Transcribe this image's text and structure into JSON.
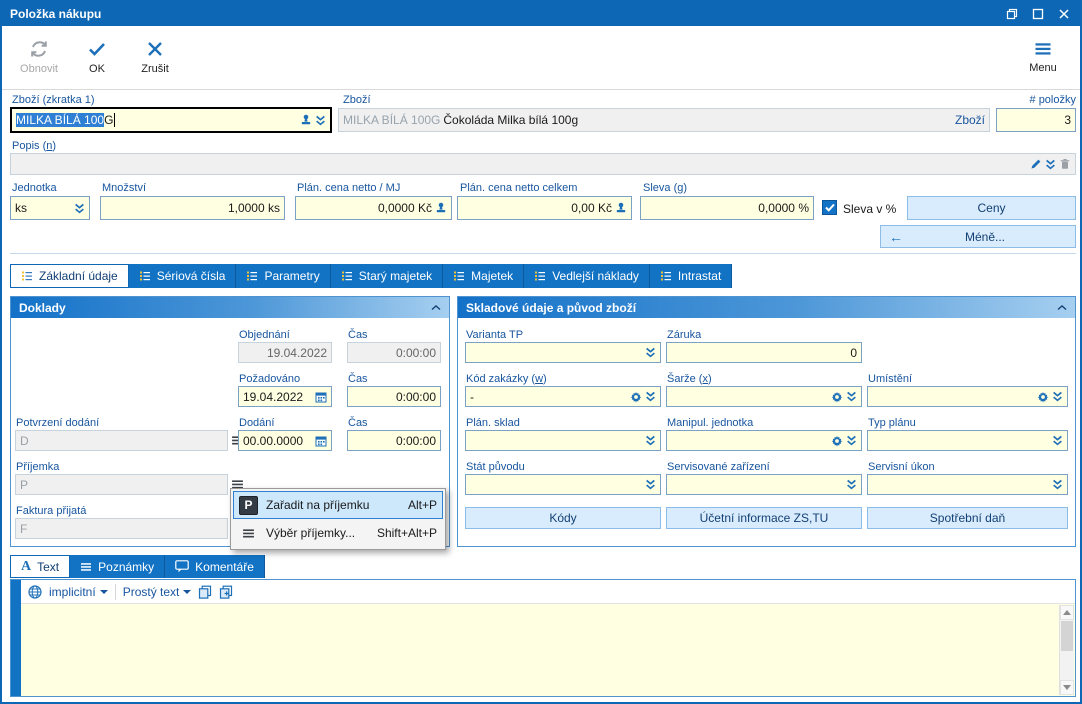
{
  "window": {
    "title": "Položka nákupu"
  },
  "toolbar": {
    "refresh_label": "Obnovit",
    "ok_label": "OK",
    "cancel_label": "Zrušit",
    "menu_label": "Menu"
  },
  "header": {
    "sku_label": "Zboží (zkratka 1)",
    "sku_selected": "MILKA BÍLÁ 100",
    "sku_rest": "G",
    "goods_label": "Zboží",
    "goods_code": "MILKA BÍLÁ 100G",
    "goods_name": "Čokoláda Milka bílá 100g",
    "goods_link": "Zboží",
    "item_count_label": "# položky",
    "item_count_value": "3",
    "desc_label": {
      "pre": "Popis (",
      "accel": "n",
      "post": ")"
    },
    "unit_label": "Jednotka",
    "unit_value": "ks",
    "qty_label": "Množství",
    "qty_value": "1,0000 ks",
    "price_unit_label": "Plán. cena netto / MJ",
    "price_unit_value": "0,0000 Kč",
    "price_total_label": "Plán. cena netto celkem",
    "price_total_value": "0,00 Kč",
    "discount_label": {
      "pre": "Sleva (",
      "accel": "g",
      "post": ")"
    },
    "discount_value": "0,0000 %",
    "discount_mode_label": "Sleva v %",
    "prices_button": "Ceny",
    "less_arrow": "←",
    "less_button": "Méně..."
  },
  "tabs": [
    {
      "label": "Základní údaje"
    },
    {
      "label": "Sériová čísla"
    },
    {
      "label": "Parametry"
    },
    {
      "label": "Starý majetek"
    },
    {
      "label": "Majetek"
    },
    {
      "label": "Vedlejší náklady"
    },
    {
      "label": "Intrastat"
    }
  ],
  "documents": {
    "title": "Doklady",
    "order_label": "Objednání",
    "time_label": "Čas",
    "order_date": "19.04.2022",
    "order_time": "0:00:00",
    "requested_label": "Požadováno",
    "requested_date": "19.04.2022",
    "requested_time": "0:00:00",
    "confirm_label": "Potvrzení dodání",
    "confirm_value": "D",
    "delivery_label": "Dodání",
    "delivery_date": "00.00.0000",
    "delivery_time": "0:00:00",
    "receipt_label": "Příjemka",
    "receipt_value": "P",
    "invoice_label": "Faktura přijatá",
    "invoice_value": "F"
  },
  "context_menu": {
    "item1_icon": "P",
    "item1_label": "Zařadit na příjemku",
    "item1_shortcut": "Alt+P",
    "item2_label": "Výběr příjemky...",
    "item2_shortcut": "Shift+Alt+P"
  },
  "stock": {
    "title": "Skladové údaje a původ zboží",
    "variant_label": "Varianta TP",
    "warranty_label": "Záruka",
    "warranty_value": "0",
    "order_code_label": {
      "pre": "Kód zakázky (",
      "accel": "w",
      "post": ")"
    },
    "order_code_value": "-",
    "batch_label": {
      "pre": "Šarže (",
      "accel": "x",
      "post": ")"
    },
    "location_label": "Umístění",
    "plan_warehouse_label": "Plán. sklad",
    "handling_unit_label": "Manipul. jednotka",
    "plan_type_label": "Typ plánu",
    "origin_country_label": "Stát původu",
    "serviced_device_label": "Servisované zařízení",
    "service_task_label": "Servisní úkon",
    "codes_button": "Kódy",
    "accounting_button": "Účetní informace ZS,TU",
    "excise_button": "Spotřební daň"
  },
  "bottom_tabs": {
    "text_icon": "A",
    "text_label": "Text",
    "notes_label": "Poznámky",
    "comments_label": "Komentáře"
  },
  "editor": {
    "language": "implicitní",
    "format": "Prostý text"
  },
  "colors": {
    "accent_blue": "#0d67b5",
    "field_yellow": "#ffffe1",
    "button_light_blue": "#d9ecfd",
    "selection_blue": "#2f80d4"
  }
}
